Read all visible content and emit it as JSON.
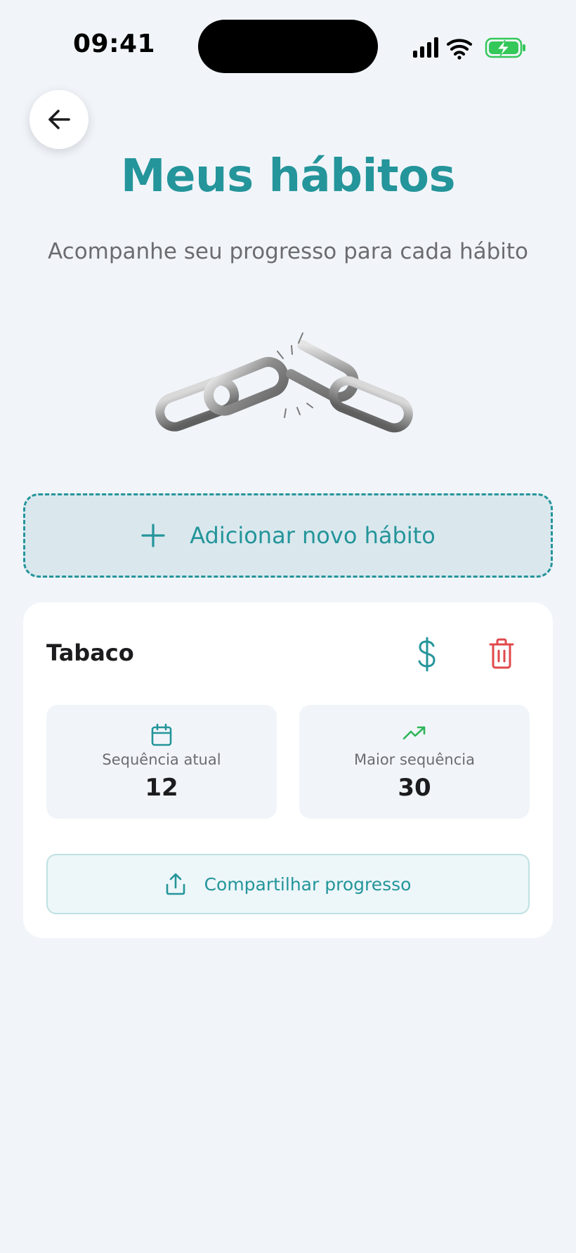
{
  "status_bar": {
    "time": "09:41"
  },
  "header": {
    "title": "Meus hábitos",
    "subtitle": "Acompanhe seu progresso para cada hábito"
  },
  "add_habit": {
    "label": "Adicionar novo hábito"
  },
  "habits": [
    {
      "name": "Tabaco",
      "stats": [
        {
          "label": "Sequência atual",
          "value": "12",
          "icon": "calendar-icon"
        },
        {
          "label": "Maior sequência",
          "value": "30",
          "icon": "trending-up-icon"
        }
      ],
      "share_label": "Compartilhar progresso"
    }
  ],
  "colors": {
    "accent": "#24959a",
    "danger": "#e0484b",
    "success": "#2fb559",
    "background": "#f1f5fa",
    "battery": "#34c759"
  },
  "icons": {
    "back": "arrow-left-icon",
    "add": "plus-icon",
    "money": "dollar-icon",
    "delete": "trash-icon",
    "share": "share-upload-icon",
    "illustration": "broken-chain-illustration"
  }
}
